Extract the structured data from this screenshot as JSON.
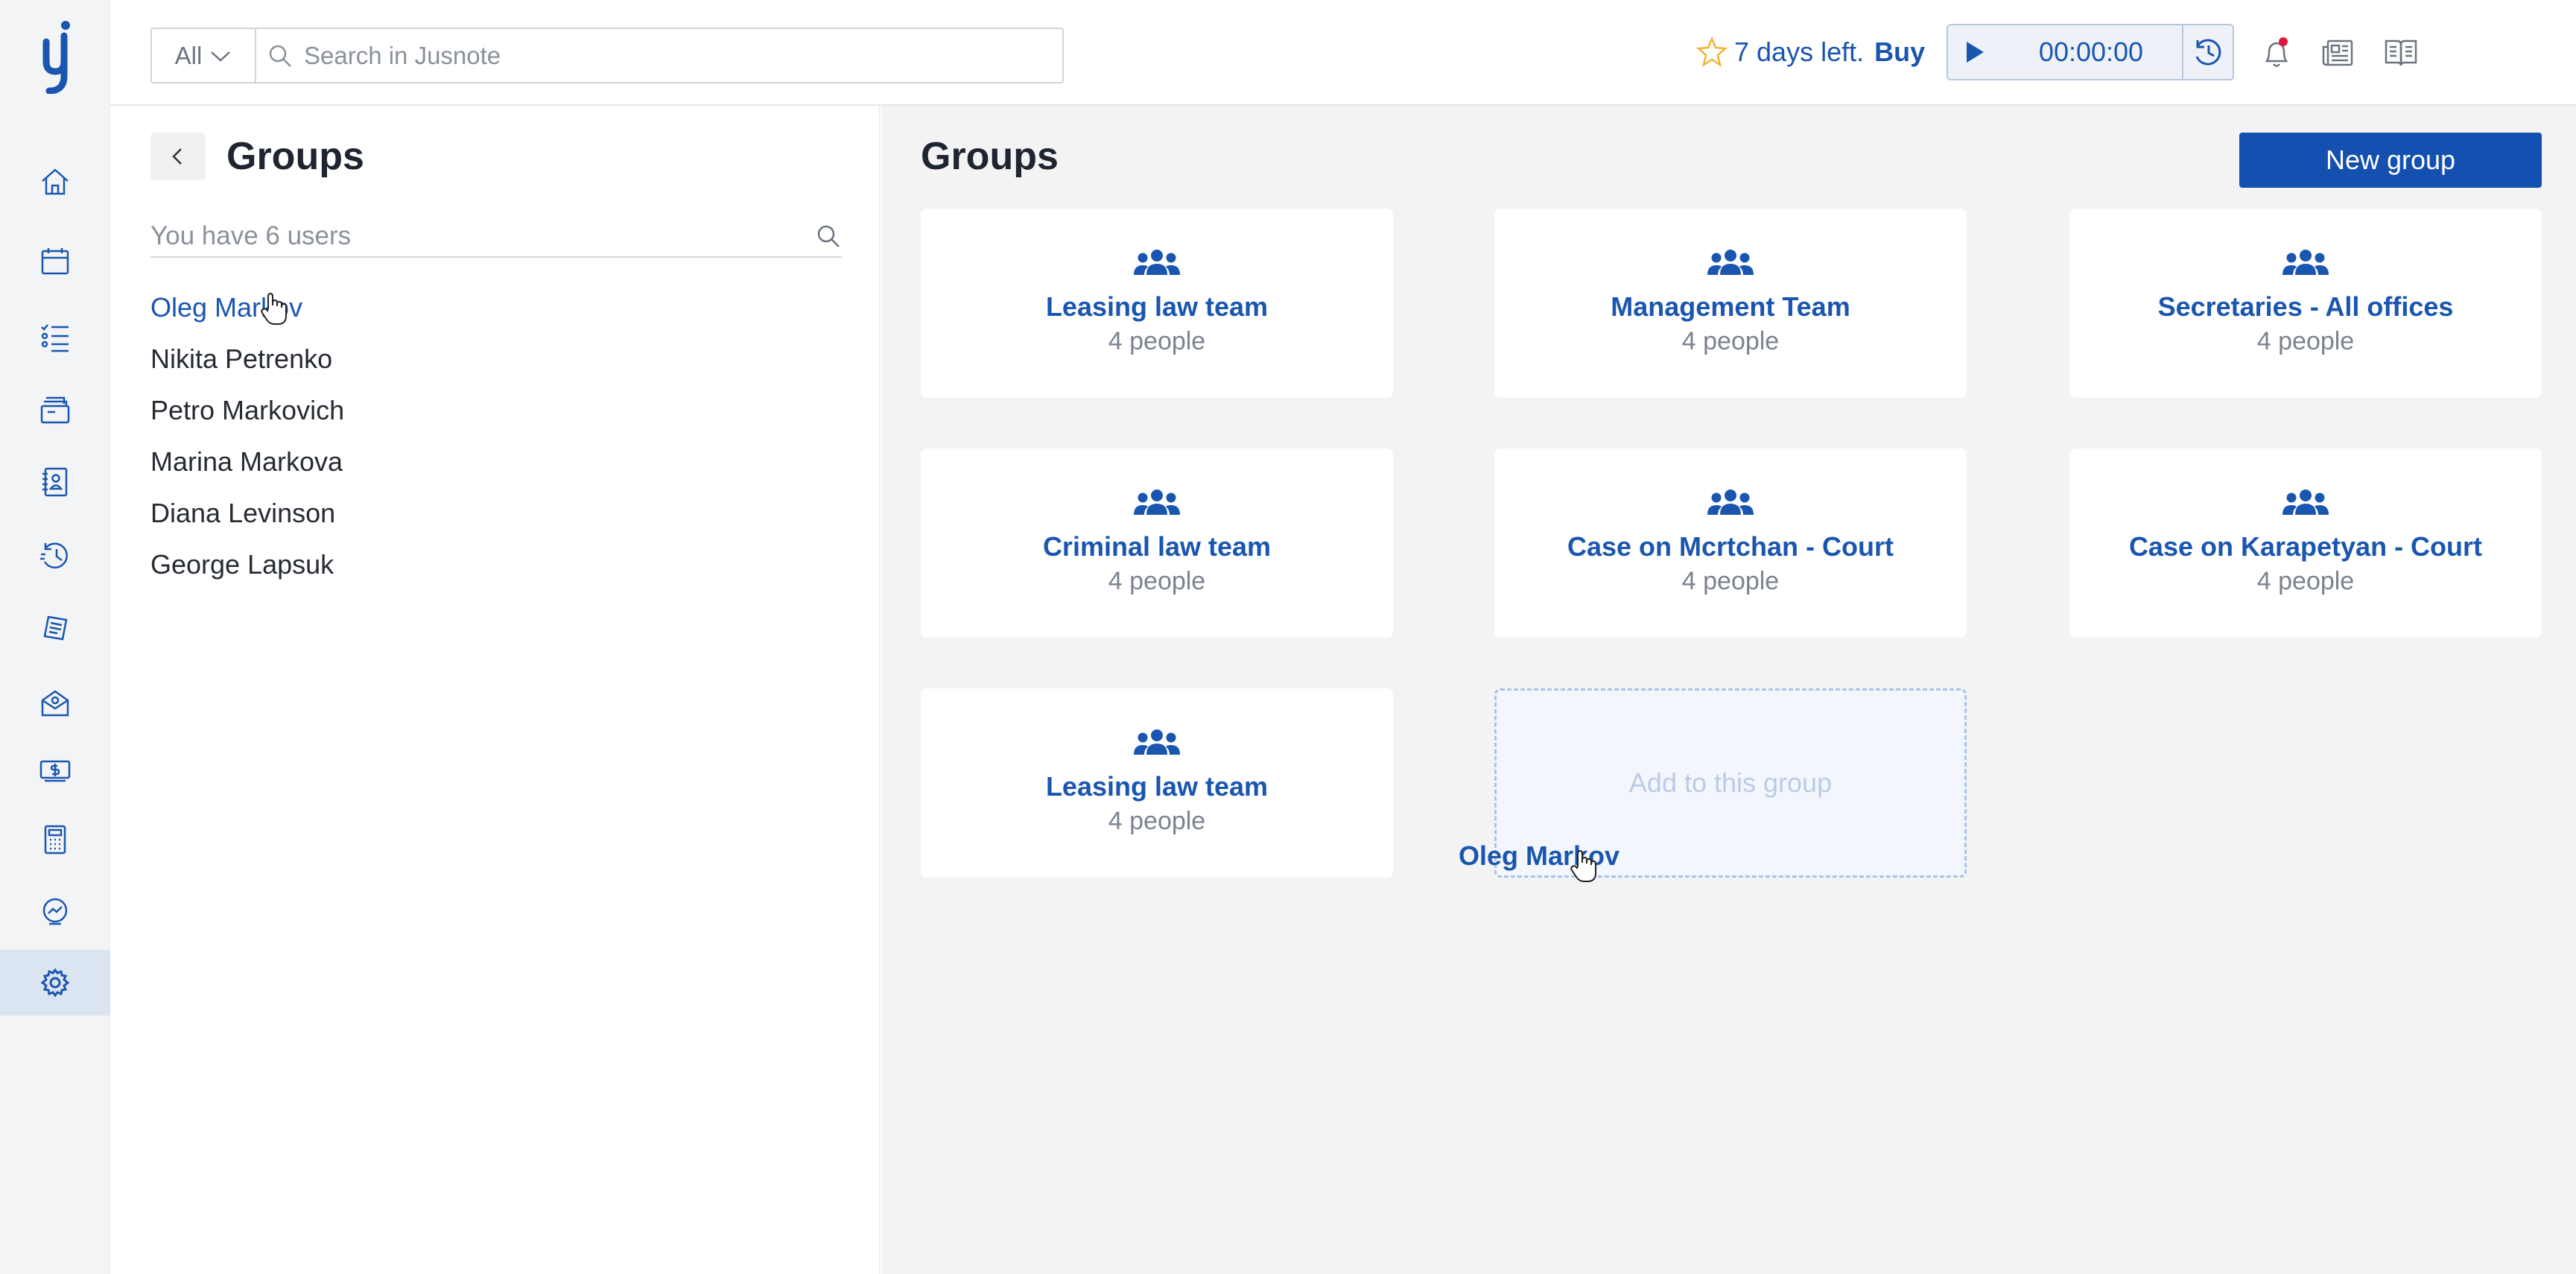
{
  "header": {
    "search_scope": "All",
    "search_placeholder": "Search in Jusnote",
    "trial_text": "7 days left.",
    "trial_buy": "Buy",
    "timer_value": "00:00:00"
  },
  "sidebar": {
    "items": [
      {
        "name": "home",
        "icon": "home-icon"
      },
      {
        "name": "calendar",
        "icon": "calendar-icon"
      },
      {
        "name": "tasks",
        "icon": "task-list-icon"
      },
      {
        "name": "matters",
        "icon": "folders-icon"
      },
      {
        "name": "contacts",
        "icon": "contacts-book-icon"
      },
      {
        "name": "time-entries",
        "icon": "history-clock-icon"
      },
      {
        "name": "billing",
        "icon": "documents-icon"
      },
      {
        "name": "communications",
        "icon": "mail-icon"
      },
      {
        "name": "payments",
        "icon": "money-icon"
      },
      {
        "name": "accounts",
        "icon": "calculator-icon"
      },
      {
        "name": "reports",
        "icon": "analytics-icon"
      },
      {
        "name": "settings",
        "icon": "gear-icon",
        "active": true
      }
    ]
  },
  "users_panel": {
    "title": "Groups",
    "search_placeholder": "You have 6 users",
    "users": [
      {
        "name": "Oleg Markov",
        "active": true
      },
      {
        "name": "Nikita Petrenko"
      },
      {
        "name": "Petro Markovich"
      },
      {
        "name": "Marina Markova"
      },
      {
        "name": "Diana Levinson"
      },
      {
        "name": "George Lapsuk"
      }
    ]
  },
  "groups": {
    "title": "Groups",
    "new_group_label": "New group",
    "cards": [
      {
        "name": "Leasing law team",
        "count": "4 people"
      },
      {
        "name": "Management Team",
        "count": "4 people"
      },
      {
        "name": "Secretaries - All offices",
        "count": "4 people"
      },
      {
        "name": "Criminal law team",
        "count": "4 people"
      },
      {
        "name": "Case on Mcrtchan - Court",
        "count": "4 people"
      },
      {
        "name": "Case on Karapetyan - Court",
        "count": "4 people"
      },
      {
        "name": "Leasing law team",
        "count": "4 people"
      }
    ],
    "drop_zone_text": "Add to this group",
    "drag_ghost_text": "Oleg Markov"
  },
  "colors": {
    "brand_blue": "#1a56b0",
    "button_blue": "#1450b0",
    "add_green": "#2fb673",
    "notification_red": "#e0173a",
    "trial_star": "#f2b233"
  }
}
